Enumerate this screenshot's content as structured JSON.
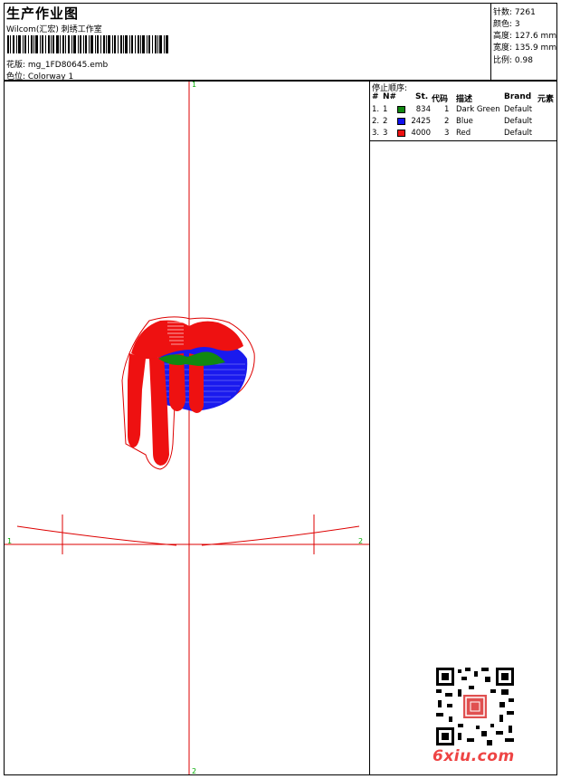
{
  "header": {
    "title": "生产作业图",
    "subtitle": "Wilcom(汇宏) 刺绣工作室",
    "design": "花版: mg_1FD80645.emb",
    "colorway": "色位: Colorway 1"
  },
  "stats": [
    {
      "label": "针数",
      "value": "7261"
    },
    {
      "label": "颜色",
      "value": "3"
    },
    {
      "label": "高度",
      "value": "127.6 mm"
    },
    {
      "label": "宽度",
      "value": "135.9 mm"
    },
    {
      "label": "比例",
      "value": "0.98"
    }
  ],
  "canvas": {
    "marker_top": "1",
    "marker_bottom": "2",
    "marker_left": "1",
    "marker_right": "2",
    "axis_color": "#dd0000",
    "marker_color": "#00aa00"
  },
  "stop_sequence": {
    "title": "停止顺序:",
    "headers": {
      "index": "#",
      "n": "N#",
      "stitches": "St.",
      "code": "代码",
      "description": "描述",
      "brand": "Brand",
      "element": "元素"
    },
    "rows": [
      {
        "index": "1.",
        "n": "1",
        "color": "#118811",
        "stitches": "834",
        "code": "1",
        "description": "Dark Green",
        "brand": "Default"
      },
      {
        "index": "2.",
        "n": "2",
        "color": "#1111ee",
        "stitches": "2425",
        "code": "2",
        "description": "Blue",
        "brand": "Default"
      },
      {
        "index": "3.",
        "n": "3",
        "color": "#ee1111",
        "stitches": "4000",
        "code": "3",
        "description": "Red",
        "brand": "Default"
      }
    ]
  },
  "watermark": "6xiu.com",
  "icons": [
    "barcode-icon",
    "qr-code-icon"
  ]
}
